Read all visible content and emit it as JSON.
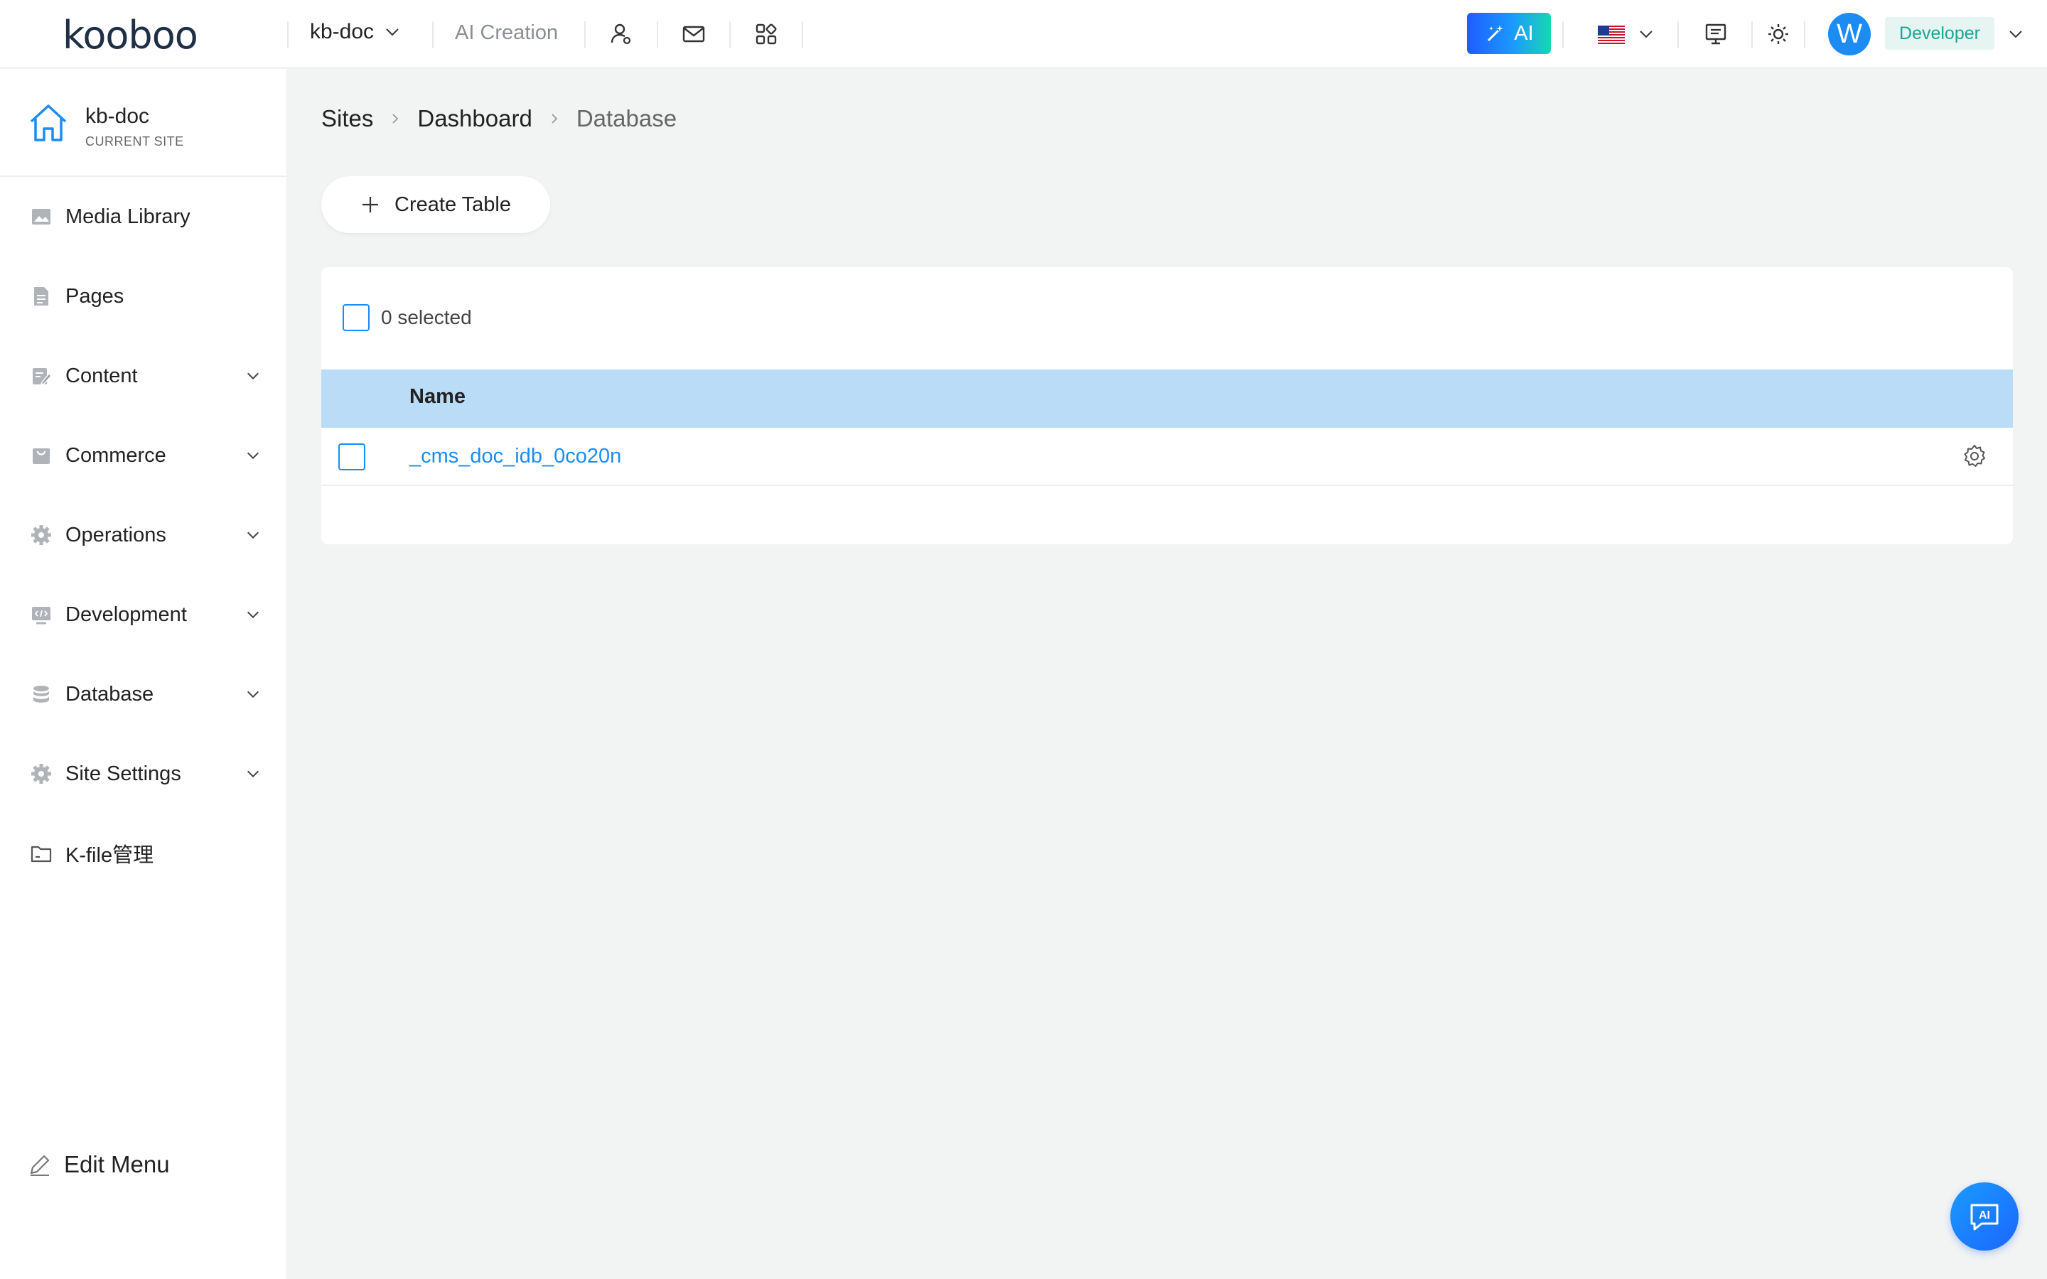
{
  "header": {
    "logo_text": "kooboo",
    "site_name": "kb-doc",
    "ai_creation_label": "AI Creation",
    "ai_button_label": "AI",
    "avatar_initial": "W",
    "role_label": "Developer"
  },
  "sidebar": {
    "current_site": {
      "name": "kb-doc",
      "subtitle": "CURRENT SITE"
    },
    "items": [
      {
        "label": "Media Library",
        "icon": "image-icon",
        "expandable": false
      },
      {
        "label": "Pages",
        "icon": "document-icon",
        "expandable": false
      },
      {
        "label": "Content",
        "icon": "edit-icon",
        "expandable": true
      },
      {
        "label": "Commerce",
        "icon": "bag-icon",
        "expandable": true
      },
      {
        "label": "Operations",
        "icon": "gear-icon",
        "expandable": true
      },
      {
        "label": "Development",
        "icon": "code-icon",
        "expandable": true
      },
      {
        "label": "Database",
        "icon": "database-icon",
        "expandable": true
      },
      {
        "label": "Site Settings",
        "icon": "gear-icon",
        "expandable": true
      },
      {
        "label": "K-file管理",
        "icon": "folder-icon",
        "expandable": false
      }
    ],
    "edit_menu_label": "Edit Menu"
  },
  "breadcrumb": [
    "Sites",
    "Dashboard",
    "Database"
  ],
  "toolbar": {
    "create_table_label": "Create Table"
  },
  "table": {
    "selected_text": "0 selected",
    "columns": [
      "Name"
    ],
    "rows": [
      {
        "name": "_cms_doc_idb_0co20n"
      }
    ]
  },
  "colors": {
    "accent": "#1c8cf2",
    "header_row": "#bbdcf7",
    "role_badge_text": "#1aa692"
  }
}
